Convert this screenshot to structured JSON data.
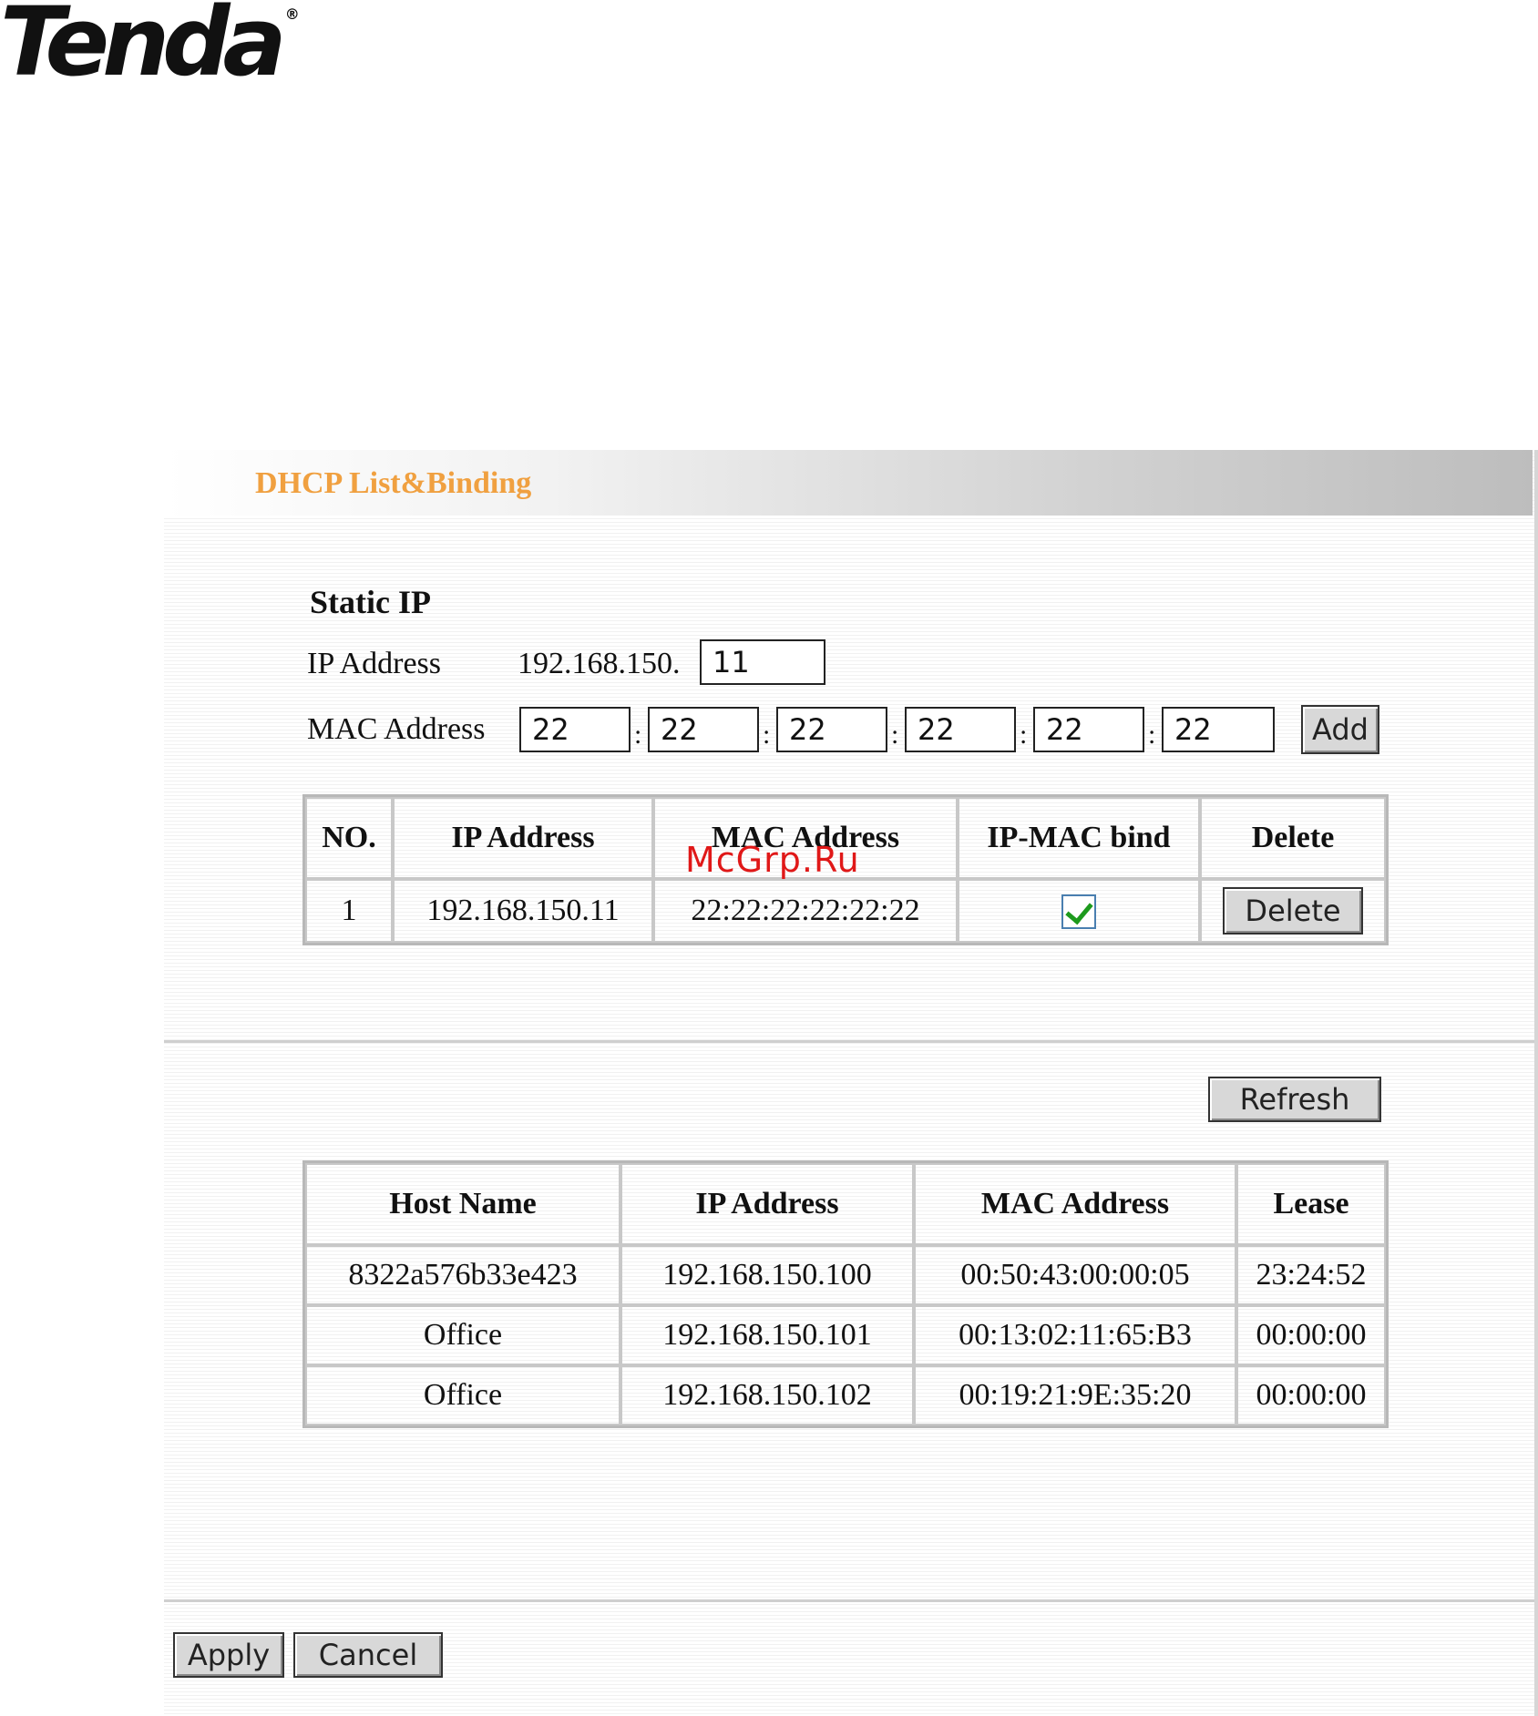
{
  "logo": {
    "text": "Tenda",
    "mark": "®"
  },
  "header": {
    "title": "DHCP List&Binding"
  },
  "static_ip": {
    "section_title": "Static IP",
    "ip_label": "IP Address",
    "ip_prefix": "192.168.150.",
    "ip_last_octet": "11",
    "mac_label": "MAC Address",
    "mac_octets": [
      "22",
      "22",
      "22",
      "22",
      "22",
      "22"
    ],
    "separator": ":",
    "add_label": "Add"
  },
  "binding_table": {
    "headers": [
      "NO.",
      "IP Address",
      "MAC Address",
      "IP-MAC bind",
      "Delete"
    ],
    "rows": [
      {
        "no": "1",
        "ip": "192.168.150.11",
        "mac": "22:22:22:22:22:22",
        "bind_checked": true,
        "delete_label": "Delete"
      }
    ]
  },
  "refresh_label": "Refresh",
  "client_table": {
    "headers": [
      "Host Name",
      "IP Address",
      "MAC Address",
      "Lease"
    ],
    "rows": [
      {
        "host": "8322a576b33e423",
        "ip": "192.168.150.100",
        "mac": "00:50:43:00:00:05",
        "lease": "23:24:52"
      },
      {
        "host": "Office",
        "ip": "192.168.150.101",
        "mac": "00:13:02:11:65:B3",
        "lease": "00:00:00"
      },
      {
        "host": "Office",
        "ip": "192.168.150.102",
        "mac": "00:19:21:9E:35:20",
        "lease": "00:00:00"
      }
    ]
  },
  "footer": {
    "apply_label": "Apply",
    "cancel_label": "Cancel"
  },
  "watermark": "McGrp.Ru",
  "colors": {
    "title_accent": "#f0a040",
    "check_green": "#1d9a1d",
    "watermark_red": "#e01818"
  }
}
